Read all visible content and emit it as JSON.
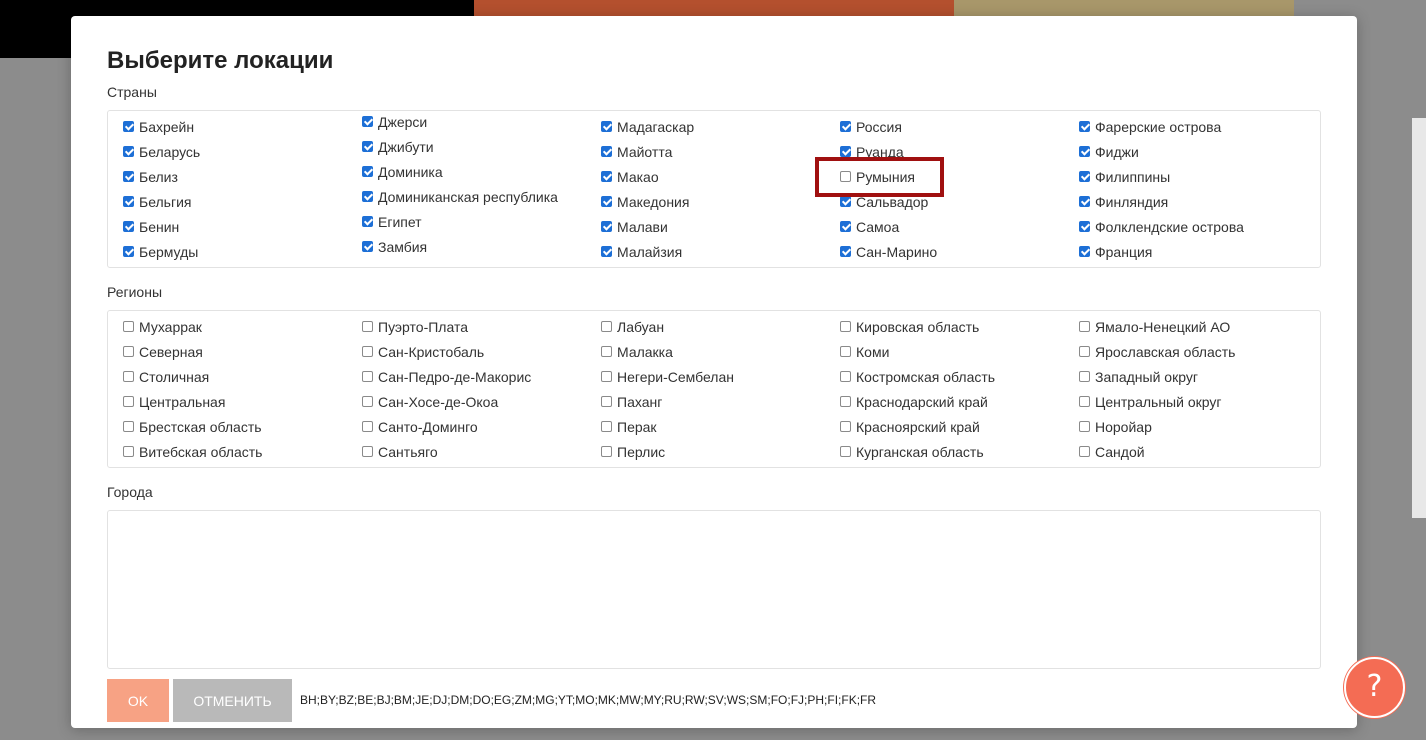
{
  "modal": {
    "title": "Выберите локации",
    "countries_label": "Страны",
    "regions_label": "Регионы",
    "cities_label": "Города",
    "ok_label": "OK",
    "cancel_label": "ОТМЕНИТЬ",
    "selected_codes": "BH;BY;BZ;BE;BJ;BM;JE;DJ;DM;DO;EG;ZM;MG;YT;MO;MK;MW;MY;RU;RW;SV;WS;SM;FO;FJ;PH;FI;FK;FR",
    "help_label": "?"
  },
  "countries": [
    [
      {
        "label": "Бахрейн",
        "checked": true
      },
      {
        "label": "Беларусь",
        "checked": true
      },
      {
        "label": "Белиз",
        "checked": true
      },
      {
        "label": "Бельгия",
        "checked": true
      },
      {
        "label": "Бенин",
        "checked": true
      },
      {
        "label": "Бермуды",
        "checked": true
      }
    ],
    [
      {
        "label": "Джерси",
        "checked": true
      },
      {
        "label": "Джибути",
        "checked": true
      },
      {
        "label": "Доминика",
        "checked": true
      },
      {
        "label": "Доминиканская республика",
        "checked": true
      },
      {
        "label": "Египет",
        "checked": true
      },
      {
        "label": "Замбия",
        "checked": true
      }
    ],
    [
      {
        "label": "Мадагаскар",
        "checked": true
      },
      {
        "label": "Майотта",
        "checked": true
      },
      {
        "label": "Макао",
        "checked": true
      },
      {
        "label": "Македония",
        "checked": true
      },
      {
        "label": "Малави",
        "checked": true
      },
      {
        "label": "Малайзия",
        "checked": true
      }
    ],
    [
      {
        "label": "Россия",
        "checked": true
      },
      {
        "label": "Руанда",
        "checked": true
      },
      {
        "label": "Румыния",
        "checked": false
      },
      {
        "label": "Сальвадор",
        "checked": true
      },
      {
        "label": "Самоа",
        "checked": true
      },
      {
        "label": "Сан-Марино",
        "checked": true
      }
    ],
    [
      {
        "label": "Фарерские острова",
        "checked": true
      },
      {
        "label": "Фиджи",
        "checked": true
      },
      {
        "label": "Филиппины",
        "checked": true
      },
      {
        "label": "Финляндия",
        "checked": true
      },
      {
        "label": "Фолклендские острова",
        "checked": true
      },
      {
        "label": "Франция",
        "checked": true
      }
    ]
  ],
  "regions": [
    [
      {
        "label": "Мухаррак",
        "checked": false
      },
      {
        "label": "Северная",
        "checked": false
      },
      {
        "label": "Столичная",
        "checked": false
      },
      {
        "label": "Центральная",
        "checked": false
      },
      {
        "label": "Брестская область",
        "checked": false
      },
      {
        "label": "Витебская область",
        "checked": false
      }
    ],
    [
      {
        "label": "Пуэрто-Плата",
        "checked": false
      },
      {
        "label": "Сан-Кристобаль",
        "checked": false
      },
      {
        "label": "Сан-Педро-де-Макорис",
        "checked": false
      },
      {
        "label": "Сан-Хосе-де-Окоа",
        "checked": false
      },
      {
        "label": "Санто-Доминго",
        "checked": false
      },
      {
        "label": "Сантьяго",
        "checked": false
      }
    ],
    [
      {
        "label": "Лабуан",
        "checked": false
      },
      {
        "label": "Малакка",
        "checked": false
      },
      {
        "label": "Негери-Сембелан",
        "checked": false
      },
      {
        "label": "Паханг",
        "checked": false
      },
      {
        "label": "Перак",
        "checked": false
      },
      {
        "label": "Перлис",
        "checked": false
      }
    ],
    [
      {
        "label": "Кировская область",
        "checked": false
      },
      {
        "label": "Коми",
        "checked": false
      },
      {
        "label": "Костромская область",
        "checked": false
      },
      {
        "label": "Краснодарский край",
        "checked": false
      },
      {
        "label": "Красноярский край",
        "checked": false
      },
      {
        "label": "Курганская область",
        "checked": false
      }
    ],
    [
      {
        "label": "Ямало-Ненецкий АО",
        "checked": false
      },
      {
        "label": "Ярославская область",
        "checked": false
      },
      {
        "label": "Западный округ",
        "checked": false
      },
      {
        "label": "Центральный округ",
        "checked": false
      },
      {
        "label": "Норойар",
        "checked": false
      },
      {
        "label": "Сандой",
        "checked": false
      }
    ]
  ],
  "colors": {
    "accent_checkbox": "#1d6fd6",
    "ok_button": "#f7a284",
    "cancel_button": "#b9b9b9",
    "help_button": "#f46c54",
    "highlight_box": "#a01010"
  }
}
